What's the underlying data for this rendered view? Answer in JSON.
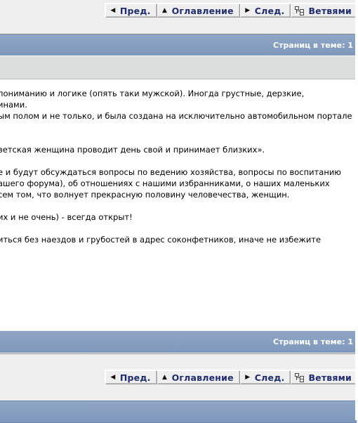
{
  "nav": {
    "prev": "Пред.",
    "contents": "Оглавление",
    "next": "След.",
    "branches": "Ветвями"
  },
  "thread": {
    "pages_label_top": "Страниц в теме: 1",
    "pages_label_bottom": "Страниц в теме: 1"
  },
  "content": {
    "lines": [
      "пониманию и логике (опять таки мужской). Иногда грустные, дерзкие,",
      "инами.",
      "ым полом и не только, и была создана на исключительно автомобильном портале",
      "",
      "",
      "ветская женщина проводит день свой и принимает близких».",
      "",
      "",
      "е и будут обсуждаться вопросы по ведению хозяйства, вопросы по воспитанию",
      "ашего форума), об отношениях с нашими избранниками, о наших маленьких",
      "сем том, что волнует прекрасную половину человечества, женщин.",
      "",
      "",
      "их и не очень) - всегда открыт!",
      "",
      "",
      "иться без наездов и грубостей в адрес соконфетников, иначе не избежите"
    ]
  }
}
